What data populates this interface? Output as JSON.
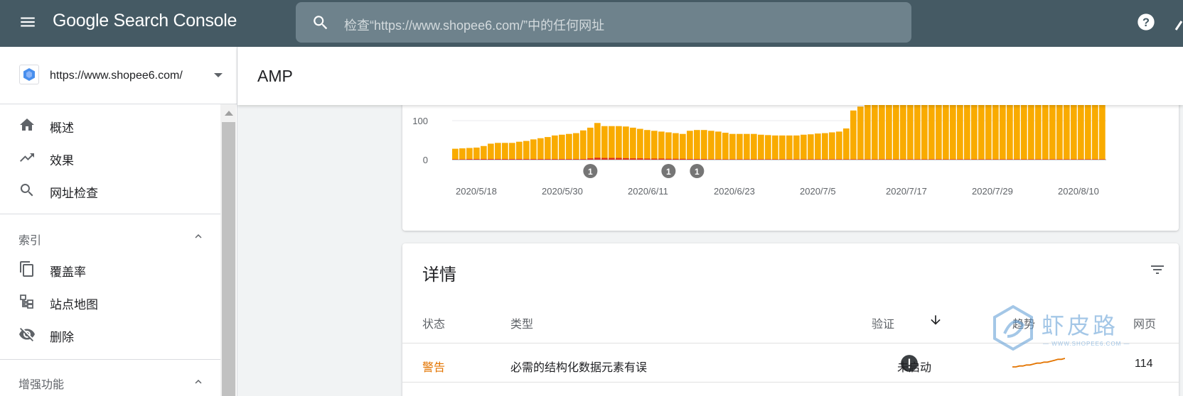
{
  "app": {
    "title": "Google Search Console",
    "search_placeholder": "检查“https://www.shopee6.com/”中的任何网址"
  },
  "sidebar": {
    "property_url": "https://www.shopee6.com/",
    "items": [
      {
        "label": "概述",
        "icon": "home-icon"
      },
      {
        "label": "效果",
        "icon": "trending-up-icon"
      },
      {
        "label": "网址检查",
        "icon": "search-icon"
      }
    ],
    "section_index": {
      "title": "索引",
      "items": [
        {
          "label": "覆盖率",
          "icon": "copy-icon"
        },
        {
          "label": "站点地图",
          "icon": "sitemap-icon"
        },
        {
          "label": "删除",
          "icon": "visibility-off-icon"
        }
      ]
    },
    "section_enhancements": {
      "title": "增强功能"
    }
  },
  "page": {
    "title": "AMP"
  },
  "chart_data": {
    "type": "bar",
    "x_tick_labels": [
      "2020/5/18",
      "2020/5/30",
      "2020/6/11",
      "2020/6/23",
      "2020/7/5",
      "2020/7/17",
      "2020/7/29",
      "2020/8/10"
    ],
    "y_tick_labels": [
      "0",
      "100"
    ],
    "ylim": [
      0,
      160
    ],
    "annotations": [
      "1",
      "1",
      "1"
    ],
    "annotation_bar_indices": [
      19,
      30,
      34
    ],
    "series": [
      {
        "color": "#f9ab00",
        "values": [
          28,
          29,
          30,
          31,
          35,
          41,
          43,
          43,
          43,
          46,
          48,
          52,
          55,
          58,
          62,
          64,
          66,
          68,
          75,
          82,
          94,
          86,
          86,
          86,
          85,
          82,
          79,
          76,
          74,
          72,
          70,
          68,
          66,
          74,
          76,
          76,
          74,
          72,
          69,
          66,
          66,
          66,
          66,
          64,
          63,
          62,
          62,
          62,
          62,
          64,
          65,
          67,
          68,
          70,
          72,
          80,
          126,
          136,
          145,
          158,
          160,
          160,
          160,
          160,
          160,
          160,
          160,
          160,
          160,
          160,
          160,
          160,
          160,
          160,
          160,
          160,
          160,
          160,
          160,
          160,
          160,
          160,
          160,
          160,
          160,
          160,
          160,
          160,
          160,
          160,
          160,
          160
        ]
      },
      {
        "color": "#d93025",
        "values": [
          2,
          2,
          3,
          3,
          3,
          3,
          3,
          3,
          3,
          3,
          3,
          3,
          3,
          3,
          3,
          3,
          3,
          3,
          3,
          6,
          9,
          8,
          8,
          8,
          7,
          6,
          6,
          5,
          5,
          5,
          4,
          4,
          4,
          3,
          3,
          3,
          2,
          2,
          2,
          2,
          2,
          2,
          2,
          2,
          2,
          2,
          2,
          2,
          2,
          2,
          2,
          2,
          2,
          2,
          2,
          2,
          2,
          2,
          2,
          2,
          2,
          2,
          2,
          2,
          2,
          2,
          2,
          2,
          2,
          2,
          2,
          2,
          2,
          2,
          2,
          2,
          2,
          2,
          2,
          2,
          2,
          2,
          2,
          2,
          2,
          2,
          2,
          2,
          2,
          2,
          2,
          2
        ]
      }
    ],
    "grid": true
  },
  "details": {
    "title": "详情",
    "columns": {
      "status": "状态",
      "type": "类型",
      "verify": "验证",
      "trend": "趋势",
      "pages": "网页"
    },
    "rows": [
      {
        "status": "警告",
        "type": "必需的结构化数据元素有误",
        "verify": "未启动",
        "pages": "114",
        "trend": [
          10,
          10,
          9,
          9,
          8,
          8,
          7,
          6,
          6,
          5,
          5,
          4,
          3,
          2,
          2,
          1
        ]
      }
    ]
  },
  "watermark": {
    "text": "虾皮路",
    "sub": "— WWW.SHOPEE6.COM —"
  },
  "colors": {
    "topbar": "#455a64",
    "accent_bar": "#f9ab00",
    "error_bar": "#d93025",
    "warning_text": "#e37400"
  }
}
